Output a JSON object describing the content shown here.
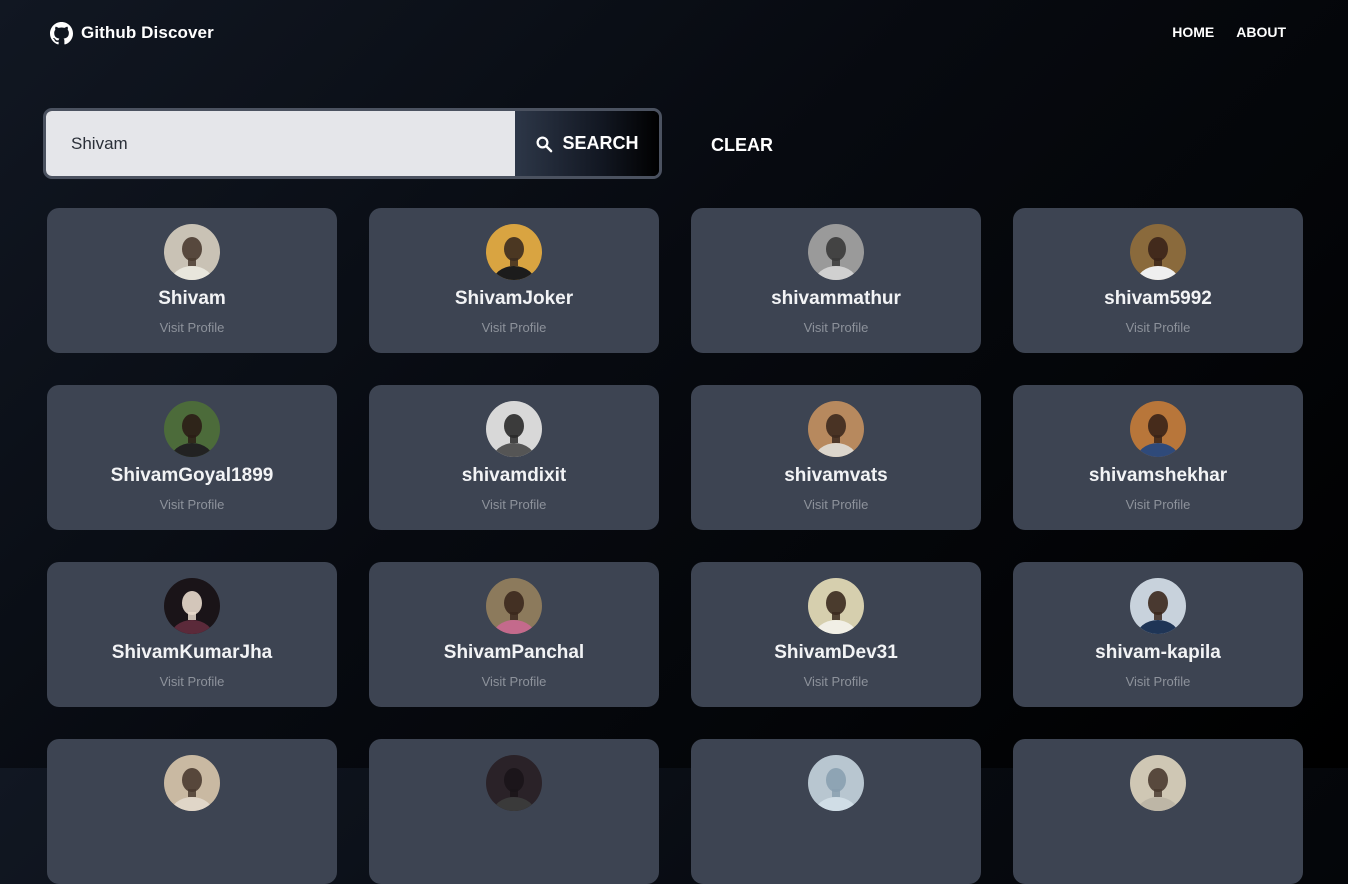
{
  "nav": {
    "brand": "Github Discover",
    "brand_icon": "github-icon",
    "links": [
      "HOME",
      "ABOUT"
    ]
  },
  "search": {
    "value": "Shivam",
    "button_label": "SEARCH",
    "button_icon": "search-icon",
    "clear_label": "CLEAR"
  },
  "results": [
    {
      "name": "Shivam",
      "link": "Visit Profile",
      "bg": "#c9c2b5",
      "fg": "#4a3b30",
      "shirt": "#e8e6dc"
    },
    {
      "name": "ShivamJoker",
      "link": "Visit Profile",
      "bg": "#d9a441",
      "fg": "#3b2b1f",
      "shirt": "#1c1c1c"
    },
    {
      "name": "shivammathur",
      "link": "Visit Profile",
      "bg": "#9a9a9a",
      "fg": "#3a3a3a",
      "shirt": "#d0d0d0"
    },
    {
      "name": "shivam5992",
      "link": "Visit Profile",
      "bg": "#8a6a3c",
      "fg": "#3a2418",
      "shirt": "#efefef"
    },
    {
      "name": "ShivamGoyal1899",
      "link": "Visit Profile",
      "bg": "#4c6b3a",
      "fg": "#2b1d16",
      "shirt": "#222222"
    },
    {
      "name": "shivamdixit",
      "link": "Visit Profile",
      "bg": "#d8d8d8",
      "fg": "#2a2a2a",
      "shirt": "#555555"
    },
    {
      "name": "shivamvats",
      "link": "Visit Profile",
      "bg": "#b7895e",
      "fg": "#3d2a1e",
      "shirt": "#dcd6cc"
    },
    {
      "name": "shivamshekhar",
      "link": "Visit Profile",
      "bg": "#b8763a",
      "fg": "#3a2418",
      "shirt": "#2f4a7a"
    },
    {
      "name": "ShivamKumarJha",
      "link": "Visit Profile",
      "bg": "#1a1418",
      "fg": "#e8d9cc",
      "shirt": "#5b2a3a"
    },
    {
      "name": "ShivamPanchal",
      "link": "Visit Profile",
      "bg": "#8c7a5c",
      "fg": "#3b281d",
      "shirt": "#c46a8c"
    },
    {
      "name": "ShivamDev31",
      "link": "Visit Profile",
      "bg": "#d6cfae",
      "fg": "#3b2a1f",
      "shirt": "#f1efe6"
    },
    {
      "name": "shivam-kapila",
      "link": "Visit Profile",
      "bg": "#c8d2dc",
      "fg": "#3b281d",
      "shirt": "#1f3556"
    },
    {
      "name": "",
      "link": "",
      "bg": "#c9b9a2",
      "fg": "#4a3b30",
      "shirt": "#e0d6c8"
    },
    {
      "name": "",
      "link": "",
      "bg": "#2a2228",
      "fg": "#1a1418",
      "shirt": "#3a3a3a"
    },
    {
      "name": "",
      "link": "",
      "bg": "#b8c6d0",
      "fg": "#8aa0b0",
      "shirt": "#d0dde6"
    },
    {
      "name": "",
      "link": "",
      "bg": "#cfc7b4",
      "fg": "#4a3b30",
      "shirt": "#bdb6a6"
    }
  ]
}
